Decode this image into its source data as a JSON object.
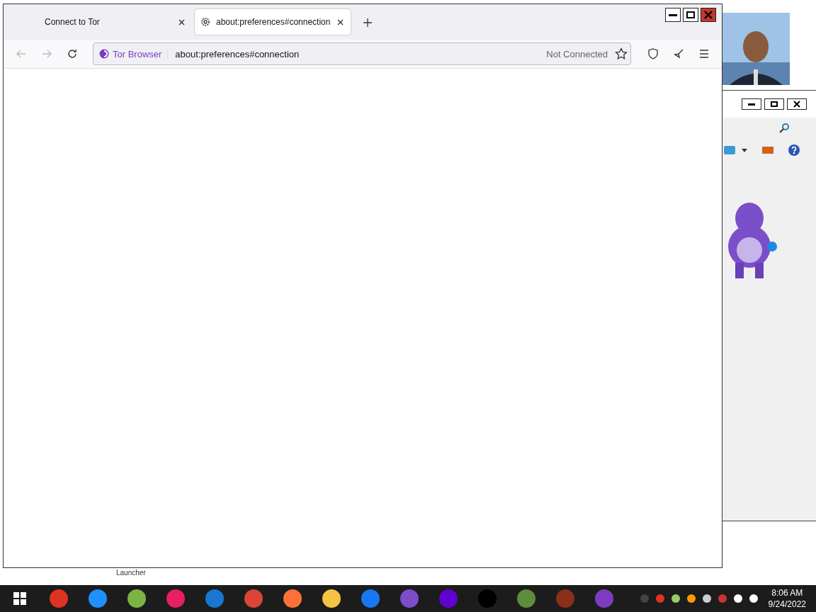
{
  "browser": {
    "tabs": [
      {
        "label": "Connect to Tor",
        "selected": false
      },
      {
        "label": "about:preferences#connection",
        "selected": true
      }
    ],
    "nav": {
      "back_disabled": true,
      "forward_disabled": true
    },
    "urlbar": {
      "identity": "Tor Browser",
      "value": "about:preferences#connection",
      "status": "Not Connected"
    }
  },
  "desktop": {
    "label": "Launcher"
  },
  "taskbar": {
    "time": "8:06 AM",
    "date": "9/24/2022"
  }
}
